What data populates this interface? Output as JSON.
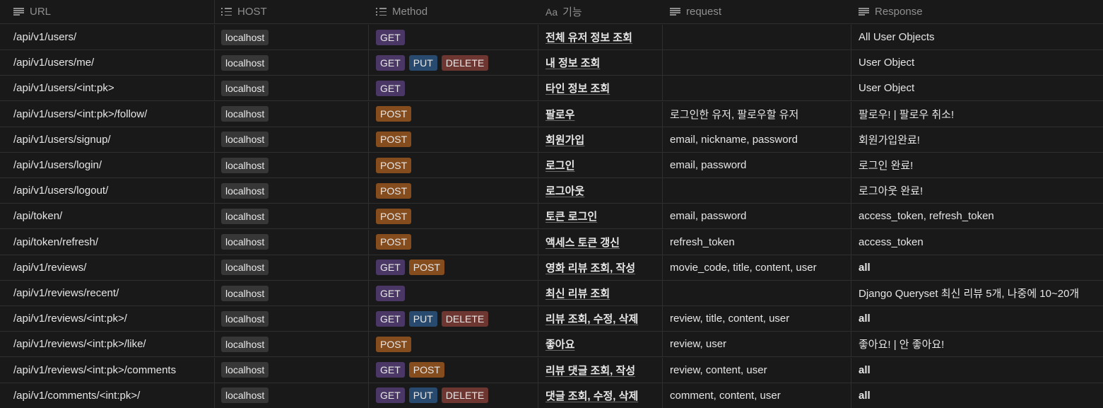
{
  "headers": {
    "url": "URL",
    "host": "HOST",
    "method": "Method",
    "func_prefix": "Aa",
    "func": "기능",
    "request": "request",
    "response": "Response"
  },
  "tag_colors": {
    "GET": "#4a3766",
    "PUT": "#284a6e",
    "DELETE": "#6e3630",
    "POST": "#854c1d",
    "host": "#373737"
  },
  "rows": [
    {
      "url": "/api/v1/users/",
      "host": "localhost",
      "methods": [
        "GET"
      ],
      "func": "전체 유저 정보 조회",
      "request": "",
      "response": "All User Objects"
    },
    {
      "url": "/api/v1/users/me/",
      "host": "localhost",
      "methods": [
        "GET",
        "PUT",
        "DELETE"
      ],
      "func": "내 정보 조회",
      "request": "",
      "response": "User Object"
    },
    {
      "url": "/api/v1/users/<int:pk>",
      "host": "localhost",
      "methods": [
        "GET"
      ],
      "func": "타인 정보 조회",
      "request": "",
      "response": "User Object"
    },
    {
      "url": "/api/v1/users/<int:pk>/follow/",
      "host": "localhost",
      "methods": [
        "POST"
      ],
      "func": "팔로우",
      "request": "로그인한 유저, 팔로우할 유저",
      "response": "팔로우! | 팔로우 취소!"
    },
    {
      "url": "/api/v1/users/signup/",
      "host": "localhost",
      "methods": [
        "POST"
      ],
      "func": "회원가입",
      "request": "email, nickname, password",
      "response": "회원가입완료!"
    },
    {
      "url": "/api/v1/users/login/",
      "host": "localhost",
      "methods": [
        "POST"
      ],
      "func": "로그인",
      "request": "email, password",
      "response": "로그인 완료!"
    },
    {
      "url": "/api/v1/users/logout/",
      "host": "localhost",
      "methods": [
        "POST"
      ],
      "func": "로그아웃",
      "request": "",
      "response": "로그아웃 완료!"
    },
    {
      "url": "/api/token/",
      "host": "localhost",
      "methods": [
        "POST"
      ],
      "func": "토큰 로그인",
      "request": "email, password",
      "response": "access_token, refresh_token"
    },
    {
      "url": "/api/token/refresh/",
      "host": "localhost",
      "methods": [
        "POST"
      ],
      "func": "액세스 토큰 갱신",
      "request": "refresh_token",
      "response": "access_token"
    },
    {
      "url": "/api/v1/reviews/",
      "host": "localhost",
      "methods": [
        "GET",
        "POST"
      ],
      "func": "영화 리뷰 조회, 작성",
      "request": "movie_code, title, content, user",
      "response": "all"
    },
    {
      "url": "/api/v1/reviews/recent/",
      "host": "localhost",
      "methods": [
        "GET"
      ],
      "func": "최신 리뷰 조회",
      "request": "",
      "response": "Django Queryset 최신 리뷰 5개, 나중에 10~20개"
    },
    {
      "url": "/api/v1/reviews/<int:pk>/",
      "host": "localhost",
      "methods": [
        "GET",
        "PUT",
        "DELETE"
      ],
      "func": "리뷰 조회, 수정, 삭제",
      "request": "review, title, content, user",
      "response": "all"
    },
    {
      "url": "/api/v1/reviews/<int:pk>/like/",
      "host": "localhost",
      "methods": [
        "POST"
      ],
      "func": "좋아요",
      "request": "review, user",
      "response": "좋아요! | 안 좋아요!"
    },
    {
      "url": "/api/v1/reviews/<int:pk>/comments",
      "host": "localhost",
      "methods": [
        "GET",
        "POST"
      ],
      "func": "리뷰 댓글 조회, 작성",
      "request": "review, content, user",
      "response": "all"
    },
    {
      "url": "/api/v1/comments/<int:pk>/",
      "host": "localhost",
      "methods": [
        "GET",
        "PUT",
        "DELETE"
      ],
      "func": "댓글 조회, 수정, 삭제",
      "request": "comment, content, user",
      "response": "all"
    }
  ]
}
